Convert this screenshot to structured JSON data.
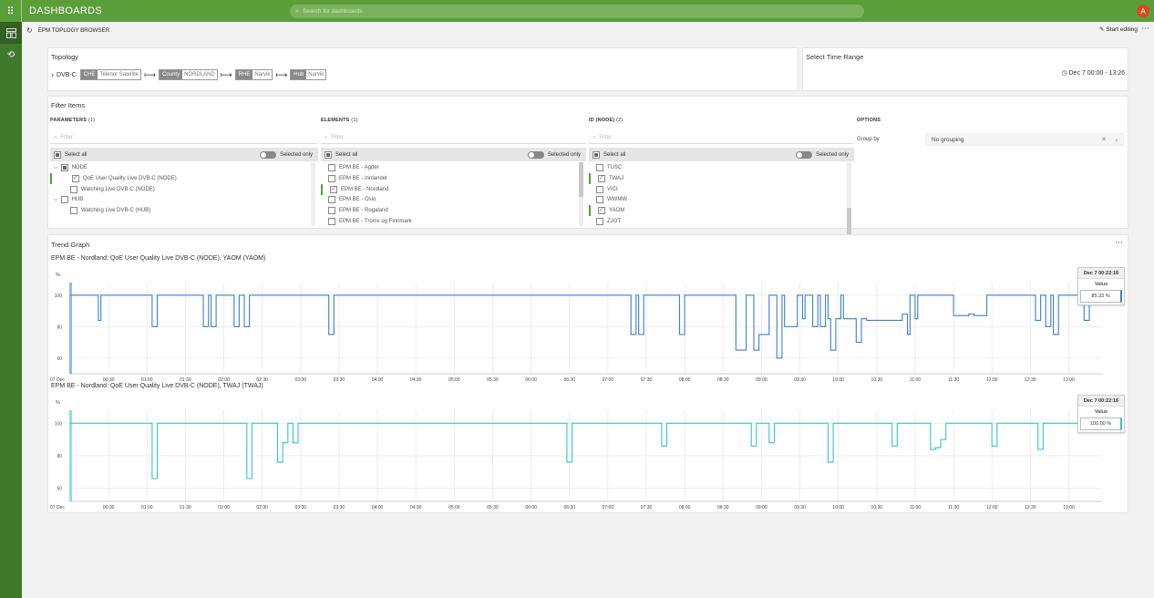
{
  "topbar": {
    "brand": "DASHBOARDS",
    "search_placeholder": "Search for dashboards",
    "avatar_initial": "A"
  },
  "subheader": {
    "title": "EPM TOPLOGY BROWSER",
    "start_editing": "Start editing",
    "more": "⋯"
  },
  "topology": {
    "title": "Topology",
    "root": "DVB-C",
    "chips": [
      {
        "key": "CHE",
        "value": "Telenor Satellite"
      },
      {
        "key": "County",
        "value": "NORDLAND"
      },
      {
        "key": "RHE",
        "value": "Narvik"
      },
      {
        "key": "Hub",
        "value": "Narvik"
      }
    ],
    "arrow": "⟼"
  },
  "time_range": {
    "title": "Select Time Range",
    "value": "Dec 7 00:00 - 13:26"
  },
  "filter": {
    "title": "Filter Items",
    "filter_placeholder": "Filter",
    "select_all": "Select all",
    "selected_only": "Selected only",
    "parameters": {
      "title": "PARAMETERS",
      "count": "(1)",
      "items": [
        {
          "label": "NODE",
          "level": 0,
          "state": "filled",
          "expander": "⌵"
        },
        {
          "label": "QoE User Quality Live DVB-C (NODE)",
          "level": 1,
          "state": "checked",
          "selected": true
        },
        {
          "label": "Watching Live DVB-C (NODE)",
          "level": 1,
          "state": "none"
        },
        {
          "label": "HUB",
          "level": 0,
          "state": "none",
          "expander": "⌵"
        },
        {
          "label": "Watching Live DVB-C (HUB)",
          "level": 1,
          "state": "none"
        }
      ]
    },
    "elements": {
      "title": "ELEMENTS",
      "count": "(1)",
      "items": [
        {
          "label": "EPM BE - Agder",
          "state": "none"
        },
        {
          "label": "EPM BE - Innlandet",
          "state": "none"
        },
        {
          "label": "EPM BE - Nordland",
          "state": "checked",
          "selected": true
        },
        {
          "label": "EPM BE - Oslo",
          "state": "none"
        },
        {
          "label": "EPM BE - Rogaland",
          "state": "none"
        },
        {
          "label": "EPM BE - Troms og Finnmark",
          "state": "none"
        }
      ]
    },
    "ids": {
      "title": "ID (NODE)",
      "count": "(2)",
      "items": [
        {
          "label": "TUSC",
          "state": "none"
        },
        {
          "label": "TWAJ",
          "state": "checked",
          "selected": true
        },
        {
          "label": "VICI",
          "state": "none"
        },
        {
          "label": "WWMW",
          "state": "none"
        },
        {
          "label": "YAOM",
          "state": "checked",
          "selected": true
        },
        {
          "label": "ZJOT",
          "state": "none"
        }
      ]
    },
    "options": {
      "title": "OPTIONS",
      "group_by_label": "Group by",
      "group_by_value": "No grouping",
      "clear": "✕",
      "chevron": "‹"
    }
  },
  "trend": {
    "title": "Trend Graph",
    "more": "⋯"
  },
  "chart_data": [
    {
      "type": "line",
      "title": "EPM BE - Nordland: QoE User Quality Live DVB-C (NODE), YAOM (YAOM)",
      "ylabel": "%",
      "ylim": [
        50,
        108
      ],
      "yticks": [
        60,
        80,
        100
      ],
      "xlim": [
        0,
        806
      ],
      "xticks": [
        {
          "x": 0,
          "label": "07 Dec"
        },
        {
          "x": 30,
          "label": "00:30"
        },
        {
          "x": 60,
          "label": "01:00"
        },
        {
          "x": 90,
          "label": "01:30"
        },
        {
          "x": 120,
          "label": "02:00"
        },
        {
          "x": 150,
          "label": "02:30"
        },
        {
          "x": 180,
          "label": "03:00"
        },
        {
          "x": 210,
          "label": "03:30"
        },
        {
          "x": 240,
          "label": "04:00"
        },
        {
          "x": 270,
          "label": "04:30"
        },
        {
          "x": 300,
          "label": "05:00"
        },
        {
          "x": 330,
          "label": "05:30"
        },
        {
          "x": 360,
          "label": "06:00"
        },
        {
          "x": 390,
          "label": "06:30"
        },
        {
          "x": 420,
          "label": "07:00"
        },
        {
          "x": 450,
          "label": "07:30"
        },
        {
          "x": 480,
          "label": "08:00"
        },
        {
          "x": 510,
          "label": "08:30"
        },
        {
          "x": 540,
          "label": "09:00"
        },
        {
          "x": 570,
          "label": "09:30"
        },
        {
          "x": 600,
          "label": "10:00"
        },
        {
          "x": 630,
          "label": "10:30"
        },
        {
          "x": 660,
          "label": "11:00"
        },
        {
          "x": 690,
          "label": "11:30"
        },
        {
          "x": 720,
          "label": "12:00"
        },
        {
          "x": 750,
          "label": "12:30"
        },
        {
          "x": 780,
          "label": "13:00"
        }
      ],
      "color": "#3d7fd1",
      "series": [
        {
          "points": [
            [
              0,
              100
            ],
            [
              22,
              100
            ],
            [
              22,
              84
            ],
            [
              24,
              84
            ],
            [
              24,
              100
            ],
            [
              64,
              100
            ],
            [
              64,
              80
            ],
            [
              68,
              80
            ],
            [
              68,
              100
            ],
            [
              104,
              100
            ],
            [
              104,
              80
            ],
            [
              108,
              80
            ],
            [
              108,
              100
            ],
            [
              110,
              100
            ],
            [
              110,
              80
            ],
            [
              114,
              80
            ],
            [
              114,
              100
            ],
            [
              128,
              100
            ],
            [
              128,
              80
            ],
            [
              132,
              80
            ],
            [
              132,
              100
            ],
            [
              136,
              100
            ],
            [
              136,
              80
            ],
            [
              140,
              80
            ],
            [
              140,
              100
            ],
            [
              202,
              100
            ],
            [
              202,
              75
            ],
            [
              206,
              75
            ],
            [
              206,
              100
            ],
            [
              438,
              100
            ],
            [
              438,
              75
            ],
            [
              442,
              75
            ],
            [
              442,
              100
            ],
            [
              444,
              100
            ],
            [
              444,
              75
            ],
            [
              448,
              75
            ],
            [
              448,
              100
            ],
            [
              476,
              100
            ],
            [
              476,
              75
            ],
            [
              480,
              75
            ],
            [
              480,
              100
            ],
            [
              520,
              100
            ],
            [
              520,
              65
            ],
            [
              528,
              65
            ],
            [
              528,
              100
            ],
            [
              534,
              100
            ],
            [
              534,
              65
            ],
            [
              538,
              65
            ],
            [
              538,
              75
            ],
            [
              546,
              75
            ],
            [
              546,
              100
            ],
            [
              552,
              100
            ],
            [
              552,
              60
            ],
            [
              556,
              60
            ],
            [
              556,
              100
            ],
            [
              558,
              100
            ],
            [
              558,
              80
            ],
            [
              568,
              80
            ],
            [
              568,
              100
            ],
            [
              572,
              100
            ],
            [
              572,
              85
            ],
            [
              574,
              85
            ],
            [
              574,
              100
            ],
            [
              580,
              100
            ],
            [
              580,
              80
            ],
            [
              584,
              80
            ],
            [
              584,
              100
            ],
            [
              586,
              100
            ],
            [
              586,
              80
            ],
            [
              590,
              80
            ],
            [
              590,
              100
            ],
            [
              592,
              100
            ],
            [
              592,
              85
            ],
            [
              594,
              85
            ],
            [
              594,
              65
            ],
            [
              598,
              65
            ],
            [
              598,
              85
            ],
            [
              602,
              85
            ],
            [
              602,
              100
            ],
            [
              604,
              100
            ],
            [
              604,
              85
            ],
            [
              614,
              85
            ],
            [
              614,
              70
            ],
            [
              618,
              70
            ],
            [
              618,
              85
            ],
            [
              622,
              85
            ],
            [
              622,
              84
            ],
            [
              650,
              84
            ],
            [
              650,
              88
            ],
            [
              654,
              88
            ],
            [
              654,
              75
            ],
            [
              656,
              75
            ],
            [
              656,
              100
            ],
            [
              660,
              100
            ],
            [
              660,
              85
            ],
            [
              662,
              85
            ],
            [
              662,
              100
            ],
            [
              690,
              100
            ],
            [
              690,
              87
            ],
            [
              702,
              87
            ],
            [
              702,
              88
            ],
            [
              706,
              88
            ],
            [
              706,
              87
            ],
            [
              716,
              87
            ],
            [
              716,
              100
            ],
            [
              754,
              100
            ],
            [
              754,
              84
            ],
            [
              758,
              84
            ],
            [
              758,
              100
            ],
            [
              762,
              100
            ],
            [
              762,
              80
            ],
            [
              766,
              80
            ],
            [
              766,
              100
            ],
            [
              768,
              100
            ],
            [
              768,
              75
            ],
            [
              772,
              75
            ],
            [
              772,
              100
            ],
            [
              792,
              100
            ],
            [
              792,
              84
            ],
            [
              796,
              84
            ],
            [
              796,
              100
            ],
            [
              806,
              100
            ]
          ]
        }
      ],
      "tooltip": {
        "date": "Dec 7 00:22:16",
        "header": "Value",
        "value": "85.33 %"
      }
    },
    {
      "type": "line",
      "title": "EPM BE - Nordland: QoE User Quality Live DVB-C (NODE), TWAJ (TWAJ)",
      "ylabel": "%",
      "ylim": [
        52,
        108
      ],
      "yticks": [
        60,
        80,
        100
      ],
      "xlim": [
        0,
        806
      ],
      "xticks": [
        {
          "x": 0,
          "label": "07 Dec"
        },
        {
          "x": 30,
          "label": "00:30"
        },
        {
          "x": 60,
          "label": "01:00"
        },
        {
          "x": 90,
          "label": "01:30"
        },
        {
          "x": 120,
          "label": "02:00"
        },
        {
          "x": 150,
          "label": "02:30"
        },
        {
          "x": 180,
          "label": "03:00"
        },
        {
          "x": 210,
          "label": "03:30"
        },
        {
          "x": 240,
          "label": "04:00"
        },
        {
          "x": 270,
          "label": "04:30"
        },
        {
          "x": 300,
          "label": "05:00"
        },
        {
          "x": 330,
          "label": "05:30"
        },
        {
          "x": 360,
          "label": "06:00"
        },
        {
          "x": 390,
          "label": "06:30"
        },
        {
          "x": 420,
          "label": "07:00"
        },
        {
          "x": 450,
          "label": "07:30"
        },
        {
          "x": 480,
          "label": "08:00"
        },
        {
          "x": 510,
          "label": "08:30"
        },
        {
          "x": 540,
          "label": "09:00"
        },
        {
          "x": 570,
          "label": "09:30"
        },
        {
          "x": 600,
          "label": "10:00"
        },
        {
          "x": 630,
          "label": "10:30"
        },
        {
          "x": 660,
          "label": "11:00"
        },
        {
          "x": 690,
          "label": "11:30"
        },
        {
          "x": 720,
          "label": "12:00"
        },
        {
          "x": 750,
          "label": "12:30"
        },
        {
          "x": 780,
          "label": "13:00"
        }
      ],
      "color": "#35c3d6",
      "series": [
        {
          "points": [
            [
              0,
              100
            ],
            [
              64,
              100
            ],
            [
              64,
              66
            ],
            [
              68,
              66
            ],
            [
              68,
              100
            ],
            [
              138,
              100
            ],
            [
              138,
              66
            ],
            [
              142,
              66
            ],
            [
              142,
              100
            ],
            [
              162,
              100
            ],
            [
              162,
              76
            ],
            [
              166,
              76
            ],
            [
              166,
              88
            ],
            [
              170,
              88
            ],
            [
              170,
              100
            ],
            [
              174,
              100
            ],
            [
              174,
              88
            ],
            [
              178,
              88
            ],
            [
              178,
              100
            ],
            [
              388,
              100
            ],
            [
              388,
              76
            ],
            [
              392,
              76
            ],
            [
              392,
              100
            ],
            [
              462,
              100
            ],
            [
              462,
              86
            ],
            [
              466,
              86
            ],
            [
              466,
              100
            ],
            [
              532,
              100
            ],
            [
              532,
              86
            ],
            [
              536,
              86
            ],
            [
              536,
              100
            ],
            [
              546,
              100
            ],
            [
              546,
              88
            ],
            [
              550,
              88
            ],
            [
              550,
              100
            ],
            [
              592,
              100
            ],
            [
              592,
              76
            ],
            [
              596,
              76
            ],
            [
              596,
              100
            ],
            [
              642,
              100
            ],
            [
              642,
              86
            ],
            [
              646,
              86
            ],
            [
              646,
              100
            ],
            [
              672,
              100
            ],
            [
              672,
              84
            ],
            [
              676,
              84
            ],
            [
              676,
              85
            ],
            [
              680,
              85
            ],
            [
              680,
              90
            ],
            [
              684,
              90
            ],
            [
              684,
              100
            ],
            [
              720,
              100
            ],
            [
              720,
              86
            ],
            [
              724,
              86
            ],
            [
              724,
              100
            ],
            [
              756,
              100
            ],
            [
              756,
              84
            ],
            [
              760,
              84
            ],
            [
              760,
              100
            ],
            [
              806,
              100
            ]
          ]
        }
      ],
      "tooltip": {
        "date": "Dec 7 00:22:16",
        "header": "Value",
        "value": "100.00 %"
      }
    }
  ]
}
